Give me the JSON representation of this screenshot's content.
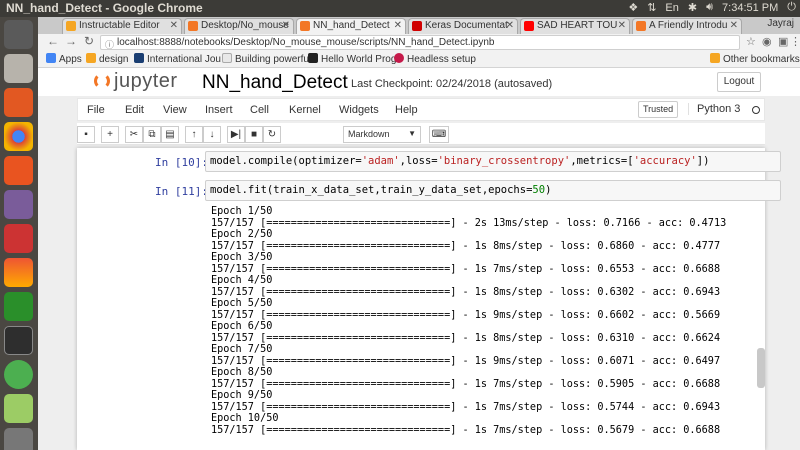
{
  "os": {
    "window_title": "NN_hand_Detect - Google Chrome",
    "time": "7:34:51 PM",
    "user": "Jayraj"
  },
  "browser": {
    "tabs": [
      {
        "label": "Instructable Editor",
        "color": "#f5a623",
        "active": false
      },
      {
        "label": "Desktop/No_mouse",
        "color": "#f37726",
        "active": false
      },
      {
        "label": "NN_hand_Detect",
        "color": "#f37726",
        "active": true
      },
      {
        "label": "Keras Documentat",
        "color": "#d00000",
        "active": false
      },
      {
        "label": "SAD HEART TOU",
        "color": "#ff0000",
        "active": false
      },
      {
        "label": "A Friendly Introdu",
        "color": "#f37726",
        "active": false
      }
    ],
    "url": "localhost:8888/notebooks/Desktop/No_mouse_mouse/scripts/NN_hand_Detect.ipynb",
    "bookmarks": [
      {
        "label": "Apps",
        "color": "#4285f4"
      },
      {
        "label": "design",
        "color": "#f5a623"
      },
      {
        "label": "International Jou",
        "color": "#1a3e72"
      },
      {
        "label": "Building powerful",
        "color": "#e8e8e8"
      },
      {
        "label": "Hello World Prog",
        "color": "#222222"
      },
      {
        "label": "Headless setup",
        "color": "#c51a4a"
      }
    ],
    "other_bookmarks": "Other bookmarks"
  },
  "jupyter": {
    "logo_text": "jupyter",
    "notebook_name": "NN_hand_Detect",
    "checkpoint": "Last Checkpoint: 02/24/2018 (autosaved)",
    "logout_label": "Logout",
    "menus": [
      "File",
      "Edit",
      "View",
      "Insert",
      "Cell",
      "Kernel",
      "Widgets",
      "Help"
    ],
    "trusted": "Trusted",
    "kernel": "Python 3",
    "cell_type": "Markdown",
    "toolbar_icons": [
      "save-icon",
      "plus-icon",
      "cut-icon",
      "copy-icon",
      "paste-icon",
      "arrow-up-icon",
      "arrow-down-icon",
      "step-forward-icon",
      "stop-icon",
      "restart-icon",
      "keyboard-icon"
    ]
  },
  "cells": [
    {
      "prompt": "In [10]:",
      "code": "model.compile(optimizer='adam',loss='binary_crossentropy',metrics=['accuracy'])"
    },
    {
      "prompt": "In [11]:",
      "code": "model.fit(train_x_data_set,train_y_data_set,epochs=50)"
    }
  ],
  "output_lines": [
    "Epoch 1/50",
    "157/157 [==============================] - 2s 13ms/step - loss: 0.7166 - acc: 0.4713",
    "Epoch 2/50",
    "157/157 [==============================] - 1s 8ms/step - loss: 0.6860 - acc: 0.4777",
    "Epoch 3/50",
    "157/157 [==============================] - 1s 7ms/step - loss: 0.6553 - acc: 0.6688",
    "Epoch 4/50",
    "157/157 [==============================] - 1s 8ms/step - loss: 0.6302 - acc: 0.6943",
    "Epoch 5/50",
    "157/157 [==============================] - 1s 9ms/step - loss: 0.6602 - acc: 0.5669",
    "Epoch 6/50",
    "157/157 [==============================] - 1s 8ms/step - loss: 0.6310 - acc: 0.6624",
    "Epoch 7/50",
    "157/157 [==============================] - 1s 9ms/step - loss: 0.6071 - acc: 0.6497",
    "Epoch 8/50",
    "157/157 [==============================] - 1s 7ms/step - loss: 0.5905 - acc: 0.6688",
    "Epoch 9/50",
    "157/157 [==============================] - 1s 7ms/step - loss: 0.5744 - acc: 0.6943",
    "Epoch 10/50",
    "157/157 [==============================] - 1s 7ms/step - loss: 0.5679 - acc: 0.6688"
  ],
  "colors": {
    "os_bar": "#3c3b37",
    "launcher": "#4a4742",
    "jupyter_orange": "#f37726",
    "prompt_blue": "#303f9f",
    "string_red": "#ba2121",
    "number_green": "#008000"
  }
}
